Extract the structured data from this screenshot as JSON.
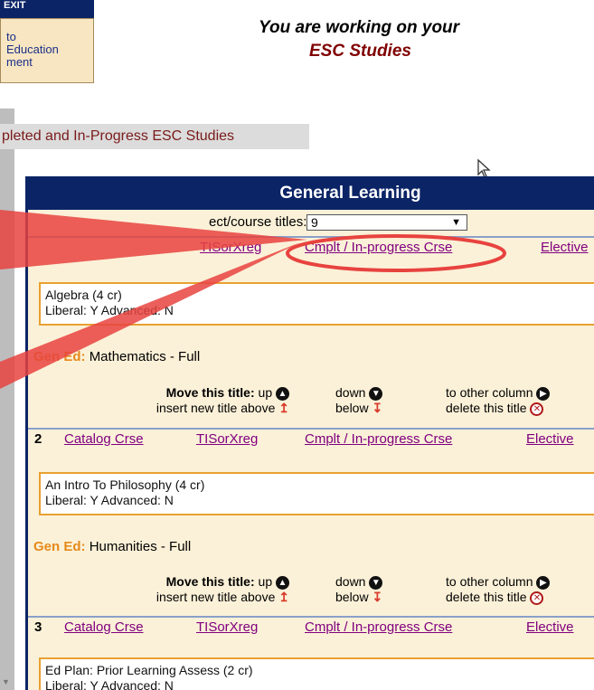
{
  "nav": {
    "exit_label": "EXIT",
    "back_lines": [
      "to",
      "Education",
      "ment"
    ]
  },
  "header": {
    "line1": "You are working on your",
    "line2": "ESC Studies"
  },
  "tabbar": {
    "label": "pleted and In-Progress ESC Studies"
  },
  "panel": {
    "title": "General Learning",
    "count_label": "ect/course titles:",
    "count_value": "9",
    "rows": [
      {
        "links": {
          "catalog": "",
          "tisorxreg": "TISorXreg",
          "cmplt": "Cmplt / In-progress Crse",
          "elective": "Elective"
        },
        "course_line1": "Algebra (4 cr)",
        "course_line2": "Liberal: Y Advanced: N",
        "gened_key": "Gen Ed:",
        "gened_value": "Mathematics - Full"
      },
      {
        "num": "2",
        "links": {
          "catalog": "Catalog Crse",
          "tisorxreg": "TISorXreg",
          "cmplt": "Cmplt / In-progress Crse",
          "elective": "Elective"
        },
        "course_line1": "An Intro To Philosophy (4 cr)",
        "course_line2": "Liberal: Y Advanced: N",
        "gened_key": "Gen Ed:",
        "gened_value": "Humanities - Full"
      },
      {
        "num": "3",
        "links": {
          "catalog": "Catalog Crse",
          "tisorxreg": "TISorXreg",
          "cmplt": "Cmplt / In-progress Crse",
          "elective": "Elective"
        },
        "course_line1": "Ed Plan: Prior Learning Assess (2 cr)",
        "course_line2": "Liberal: Y Advanced: N"
      }
    ],
    "move": {
      "move_label": "Move this title:",
      "up": "up",
      "down": "down",
      "other_column": "to other column",
      "insert_above": "insert new title above",
      "below": "below",
      "delete": "delete this title"
    }
  },
  "colors": {
    "nav_blue": "#0b2466",
    "panel_bg": "#fbf1d8",
    "link": "#800080",
    "gened_key": "#e68a1a",
    "annotation": "#e8433f"
  }
}
